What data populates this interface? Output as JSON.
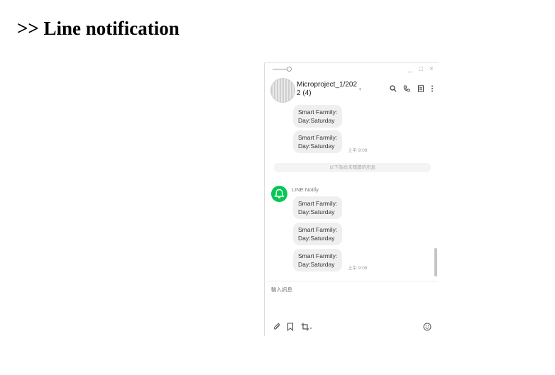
{
  "page": {
    "heading": ">> Line notification"
  },
  "window": {
    "controls": {
      "minimize": "_",
      "maximize": "□",
      "close": "×"
    },
    "chat_title": "Microproject_1/2022 (4)",
    "icons": [
      "search-icon",
      "phone-icon",
      "notes-icon",
      "more-icon",
      "sound-icon"
    ]
  },
  "messages": {
    "top": [
      {
        "text_line1": "Smart Farmily:",
        "text_line2": "Day:Saturday"
      },
      {
        "text_line1": "Smart Farmily:",
        "text_line2": "Day:Saturday",
        "time": "上午 9:09"
      }
    ],
    "unread_divider": "以下為尚未閱讀的訊息",
    "sender": "LINE Notify",
    "bottom": [
      {
        "text_line1": "Smart Farmily:",
        "text_line2": "Day:Saturday"
      },
      {
        "text_line1": "Smart Farmily:",
        "text_line2": "Day:Saturday"
      },
      {
        "text_line1": "Smart Farmily:",
        "text_line2": "Day:Saturday",
        "time": "上午 9:09"
      }
    ]
  },
  "input": {
    "placeholder": "輸入訊息"
  },
  "footer": {
    "icons": [
      "attach-icon",
      "bookmark-icon",
      "crop-icon",
      "emoji-icon"
    ]
  },
  "colors": {
    "line_green": "#06c755",
    "bubble": "#efefef"
  }
}
